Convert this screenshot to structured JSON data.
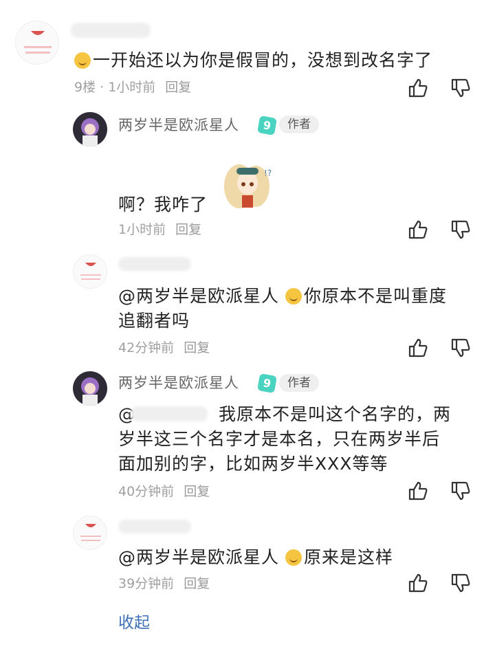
{
  "comments": [
    {
      "id": "c1",
      "text": "一开始还以为你是假冒的，没想到改名字了",
      "meta": "9楼 · 1小时前",
      "reply": "回复"
    },
    {
      "id": "c2",
      "name": "两岁半是欧派星人",
      "level": "9",
      "badge": "作者",
      "text": "啊？我咋了",
      "meta": "1小时前",
      "reply": "回复"
    },
    {
      "id": "c3",
      "mention": "@两岁半是欧派星人",
      "text_line1": "你原本不是叫重度",
      "text_line2": "追翻者吗",
      "meta": "42分钟前",
      "reply": "回复"
    },
    {
      "id": "c4",
      "name": "两岁半是欧派星人",
      "level": "9",
      "badge": "作者",
      "mention": "@",
      "text_line1": "我原本不是叫这个名字的，两",
      "text_line2": "岁半这三个名字才是本名，只在两岁半后",
      "text_line3": "面加别的字，比如两岁半XXX等等",
      "meta": "40分钟前",
      "reply": "回复"
    },
    {
      "id": "c5",
      "mention": "@两岁半是欧派星人",
      "text": "原来是这样",
      "meta": "39分钟前",
      "reply": "回复"
    }
  ],
  "collapse_label": "收起",
  "colors": {
    "link": "#3b6fb8",
    "level": "#4ad3c0",
    "meta": "#a0a0a0"
  },
  "icons": {
    "like": "thumbs-up-icon",
    "dislike": "thumbs-down-icon"
  }
}
